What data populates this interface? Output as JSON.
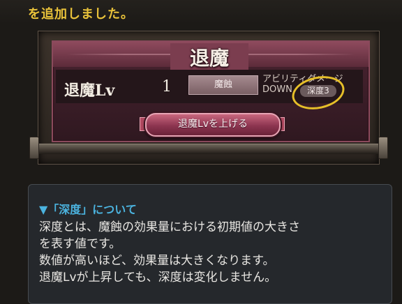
{
  "notice": {
    "text": "を追加しました。"
  },
  "panel": {
    "title": "退魔",
    "lv_label": "退魔Lv",
    "lv_value": "1",
    "corrosion_label": "魔蝕",
    "effect_line1": "アビリティダメージ",
    "effect_line2": "DOWN",
    "depth_badge": "深度3",
    "raise_button": "退魔Lvを上げる"
  },
  "info": {
    "heading": "▼「深度」について",
    "lines": [
      "深度とは、魔蝕の効果量における初期値の大きさ",
      "を表す値です。",
      "数値が高いほど、効果量は大きくなります。",
      "退魔Lvが上昇しても、深度は変化しません。"
    ]
  },
  "colors": {
    "notice_text": "#e9c23a",
    "info_heading": "#4bb3df",
    "highlight_ring": "#e6bf29",
    "panel_accent": "#8e4a5d"
  }
}
